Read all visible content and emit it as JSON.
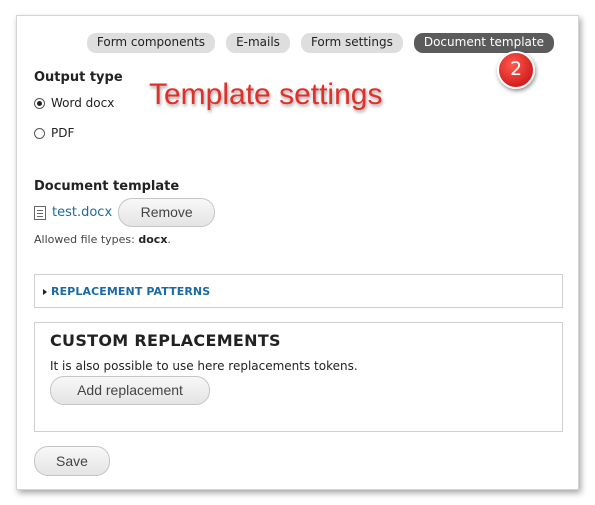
{
  "tabs": [
    {
      "label": "Form components",
      "active": false
    },
    {
      "label": "E-mails",
      "active": false
    },
    {
      "label": "Form settings",
      "active": false
    },
    {
      "label": "Document template",
      "active": true
    }
  ],
  "annotation": {
    "text": "Template settings",
    "step": "2",
    "color": "#e0302a"
  },
  "output_type": {
    "label": "Output type",
    "options": [
      {
        "label": "Word docx",
        "checked": true
      },
      {
        "label": "PDF",
        "checked": false
      }
    ]
  },
  "document_template": {
    "label": "Document template",
    "file_name": "test.docx",
    "remove_label": "Remove",
    "allowed_prefix": "Allowed file types:",
    "allowed_types": "docx",
    "allowed_suffix": "."
  },
  "replacement_patterns": {
    "label": "REPLACEMENT PATTERNS"
  },
  "custom_replacements": {
    "title": "CUSTOM REPLACEMENTS",
    "description": "It is also possible to use here replacements tokens.",
    "add_label": "Add replacement"
  },
  "save_label": "Save",
  "colors": {
    "link": "#1a6aa6",
    "active_tab": "#5b5b5b",
    "tab": "#dedede"
  }
}
